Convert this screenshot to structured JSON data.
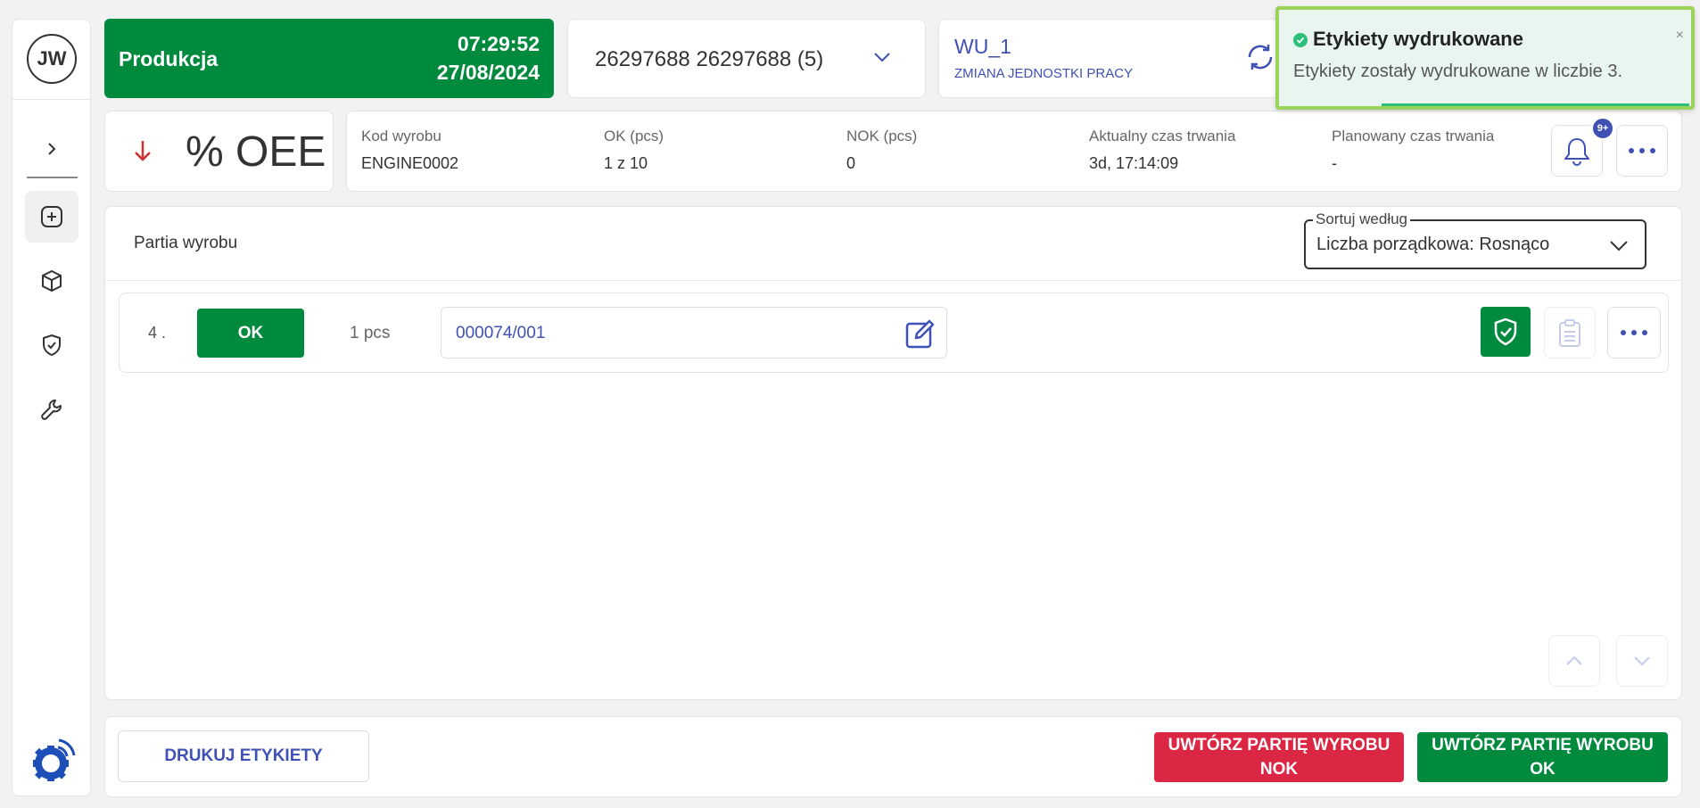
{
  "user": {
    "initials": "JW"
  },
  "status": {
    "label": "Produkcja",
    "time": "07:29:52",
    "date": "27/08/2024"
  },
  "order": {
    "value": "26297688 26297688  (5)"
  },
  "work_unit": {
    "name": "WU_1",
    "change_label": "ZMIANA JEDNOSTKI PRACY"
  },
  "toast": {
    "title": "Etykiety wydrukowane",
    "message": "Etykiety zostały wydrukowane w liczbie 3.",
    "close": "×"
  },
  "oee": {
    "value": "% OEE"
  },
  "info": {
    "product_code_label": "Kod wyrobu",
    "product_code": "ENGINE0002",
    "ok_label": "OK (pcs)",
    "ok_value": "1 z 10",
    "nok_label": "NOK (pcs)",
    "nok_value": "0",
    "current_duration_label": "Aktualny czas trwania",
    "current_duration": "3d, 17:14:09",
    "planned_duration_label": "Planowany czas trwania",
    "planned_duration": "-",
    "notification_badge": "9+"
  },
  "main": {
    "title": "Partia wyrobu",
    "sort_legend": "Sortuj według",
    "sort_value": "Liczba porządkowa: Rosnąco",
    "rows": [
      {
        "num": "4 .",
        "status": "OK",
        "qty": "1 pcs",
        "batch": "000074/001"
      }
    ]
  },
  "footer": {
    "print_label": "DRUKUJ ETYKIETY",
    "nok_label_1": "UWTÓRZ PARTIĘ WYROBU",
    "nok_label_2": "NOK",
    "ok_label_1": "UWTÓRZ PARTIĘ WYROBU",
    "ok_label_2": "OK"
  },
  "colors": {
    "green": "#008a3e",
    "red": "#dc2744",
    "blue": "#3f51b5",
    "toast_border": "#9bd25a"
  }
}
